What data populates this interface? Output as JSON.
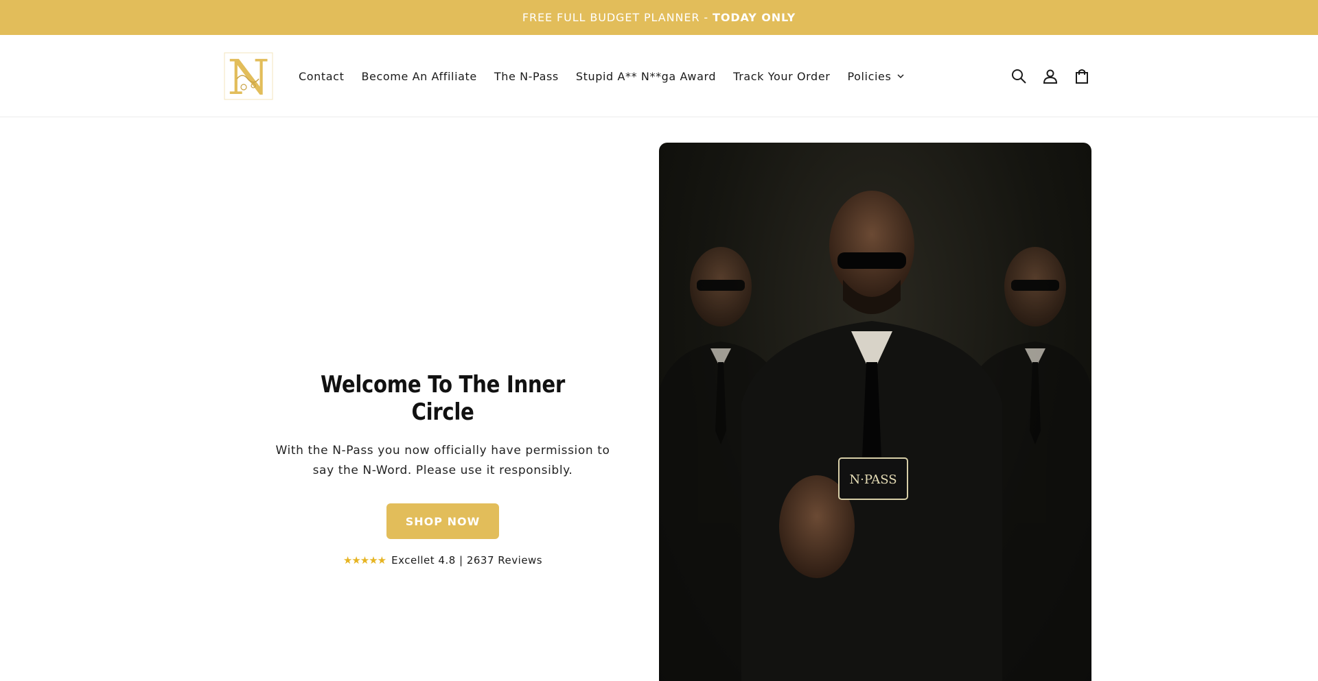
{
  "announcement": {
    "text": "FREE FULL BUDGET PLANNER -",
    "highlight": "TODAY ONLY"
  },
  "header": {
    "logo_letter": "N",
    "nav": [
      {
        "label": "Contact"
      },
      {
        "label": "Become An Affiliate"
      },
      {
        "label": "The N-Pass"
      },
      {
        "label": "Stupid A** N**ga Award"
      },
      {
        "label": "Track Your Order"
      },
      {
        "label": "Policies",
        "dropdown": true
      }
    ],
    "icons": [
      "search-icon",
      "account-icon",
      "cart-icon"
    ]
  },
  "hero": {
    "title": "Welcome To The Inner Circle",
    "subtitle": "With the N-Pass you now officially have permission to say the N-Word. Please use it responsibly.",
    "cta_label": "SHOP NOW",
    "rating_stars": "★★★★★",
    "rating_text": "Excellet 4.8 | 2637 Reviews",
    "card_text": "N·PASS"
  },
  "colors": {
    "brand_gold": "#e2bd5a",
    "star": "#e6b422",
    "text": "#121212"
  }
}
